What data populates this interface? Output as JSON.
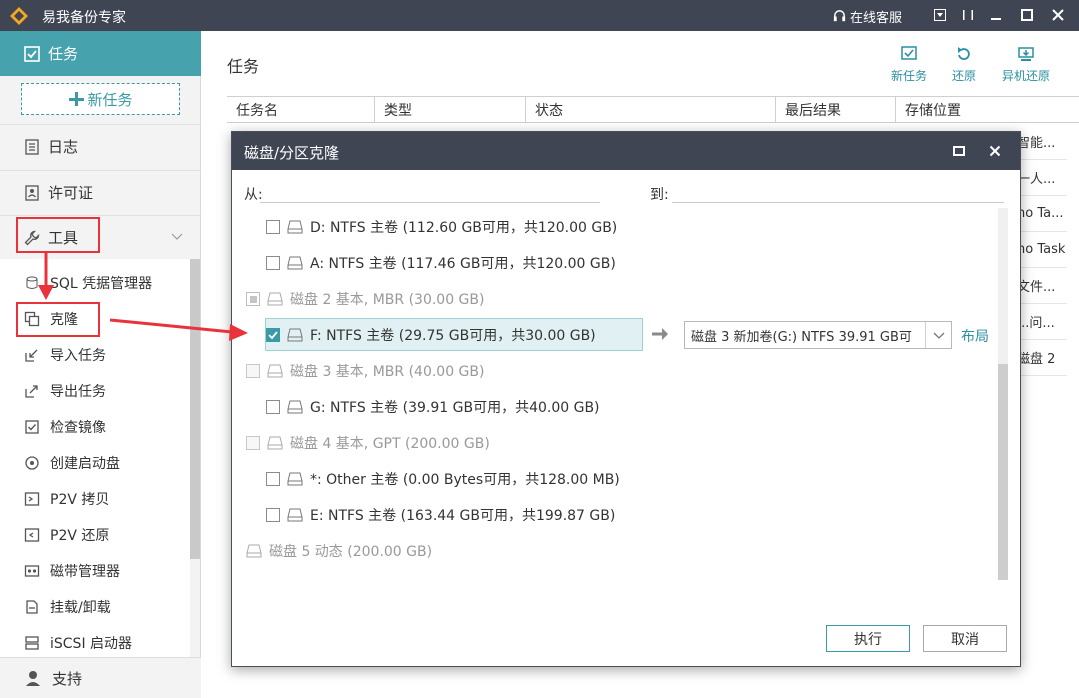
{
  "app": {
    "title": "易我备份专家",
    "online_service": "在线客服"
  },
  "sidebar": {
    "task_label": "任务",
    "new_task_label": "新任务",
    "log_label": "日志",
    "license_label": "许可证",
    "tools_label": "工具",
    "tools_items": [
      {
        "label": "SQL 凭据管理器",
        "icon": "database-icon"
      },
      {
        "label": "克隆",
        "icon": "clone-icon"
      },
      {
        "label": "导入任务",
        "icon": "import-icon"
      },
      {
        "label": "导出任务",
        "icon": "export-icon"
      },
      {
        "label": "检查镜像",
        "icon": "check-icon"
      },
      {
        "label": "创建启动盘",
        "icon": "boot-disk-icon"
      },
      {
        "label": "P2V 拷贝",
        "icon": "p2v-icon"
      },
      {
        "label": "P2V 还原",
        "icon": "p2v-restore-icon"
      },
      {
        "label": "磁带管理器",
        "icon": "tape-icon"
      },
      {
        "label": "挂载/卸载",
        "icon": "mount-icon"
      },
      {
        "label": "iSCSI 启动器",
        "icon": "iscsi-icon"
      }
    ],
    "support_label": "支持"
  },
  "main": {
    "title": "任务",
    "toolbar": {
      "new_task": "新任务",
      "restore": "还原",
      "offsite_restore": "异机还原"
    },
    "columns": [
      "任务名",
      "类型",
      "状态",
      "最后结果",
      "存储位置"
    ],
    "storage_fragments": [
      "智能...",
      "一人...",
      "no Ta...",
      "no Task",
      "文件...",
      "...问...",
      "磁盘 2"
    ]
  },
  "dialog": {
    "title": "磁盘/分区克隆",
    "from_label": "从:",
    "to_label": "到:",
    "source_rows": [
      {
        "type": "partition",
        "label": "D: NTFS 主卷 (112.60 GB可用，共120.00 GB)",
        "checked": false
      },
      {
        "type": "partition",
        "label": "A: NTFS 主卷 (117.46 GB可用，共120.00 GB)",
        "checked": false
      },
      {
        "type": "disk",
        "label": "磁盘 2 基本, MBR (30.00 GB)",
        "state": "partial"
      },
      {
        "type": "partition",
        "label": "F: NTFS 主卷 (29.75 GB可用，共30.00 GB)",
        "checked": true
      },
      {
        "type": "disk",
        "label": "磁盘 3 基本, MBR (40.00 GB)",
        "state": "disabled"
      },
      {
        "type": "partition",
        "label": "G: NTFS 主卷 (39.91 GB可用，共40.00 GB)",
        "checked": false
      },
      {
        "type": "disk",
        "label": "磁盘 4 基本, GPT (200.00 GB)",
        "state": "disabled"
      },
      {
        "type": "partition",
        "label": "*: Other 主卷 (0.00 Bytes可用，共128.00 MB)",
        "checked": false
      },
      {
        "type": "partition",
        "label": "E: NTFS 主卷 (163.44 GB可用，共199.87 GB)",
        "checked": false
      },
      {
        "type": "dynamic",
        "label": "磁盘 5 动态 (200.00 GB)"
      }
    ],
    "target_value": "磁盘 3 新加卷(G:) NTFS 39.91 GB可",
    "layout_link": "布局",
    "execute_label": "执行",
    "cancel_label": "取消"
  },
  "colors": {
    "accent": "#46a2ac",
    "titlebar": "#3f4553",
    "annotation": "#e8333b"
  }
}
